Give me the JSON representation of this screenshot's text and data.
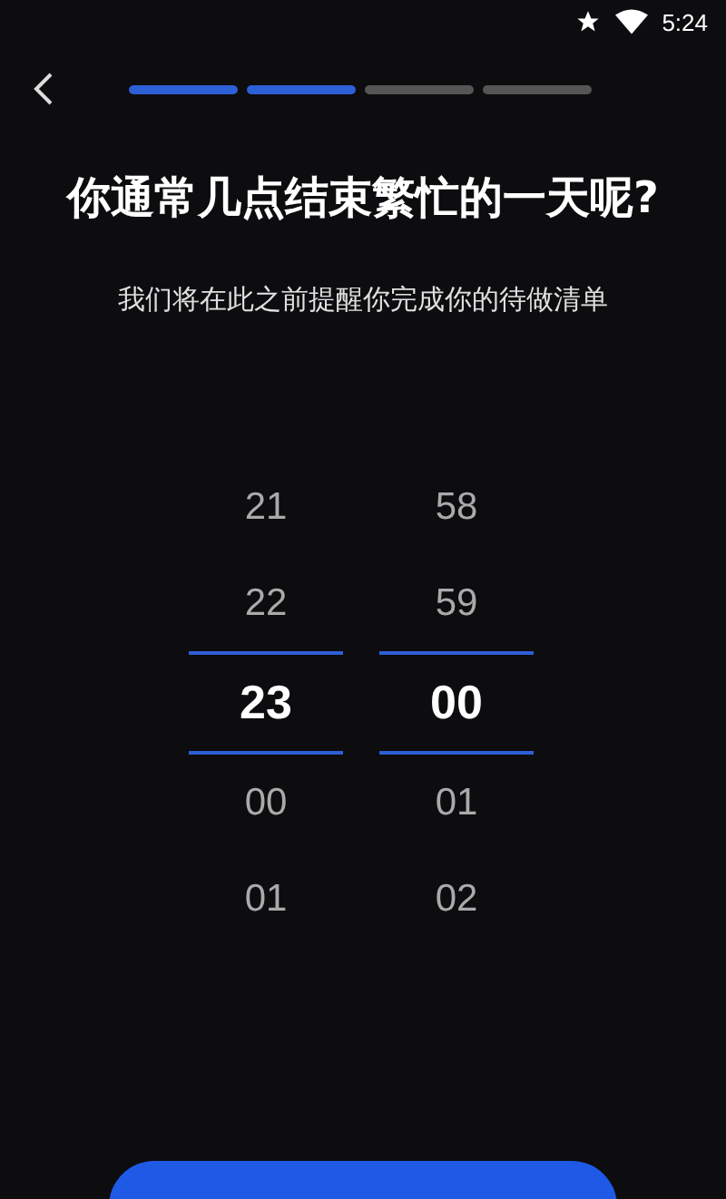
{
  "status_bar": {
    "time": "5:24"
  },
  "progress": [
    {
      "done": true
    },
    {
      "done": true
    },
    {
      "done": false
    },
    {
      "done": false
    }
  ],
  "title": "你通常几点结束繁忙的一天呢?",
  "subtitle": "我们将在此之前提醒你完成你的待做清单",
  "pickers": [
    {
      "items": [
        {
          "label": "21",
          "selected": false
        },
        {
          "label": "22",
          "selected": false
        },
        {
          "label": "23",
          "selected": true
        },
        {
          "label": "00",
          "selected": false
        },
        {
          "label": "01",
          "selected": false
        }
      ]
    },
    {
      "items": [
        {
          "label": "58",
          "selected": false
        },
        {
          "label": "59",
          "selected": false
        },
        {
          "label": "00",
          "selected": true
        },
        {
          "label": "01",
          "selected": false
        },
        {
          "label": "02",
          "selected": false
        }
      ]
    }
  ]
}
